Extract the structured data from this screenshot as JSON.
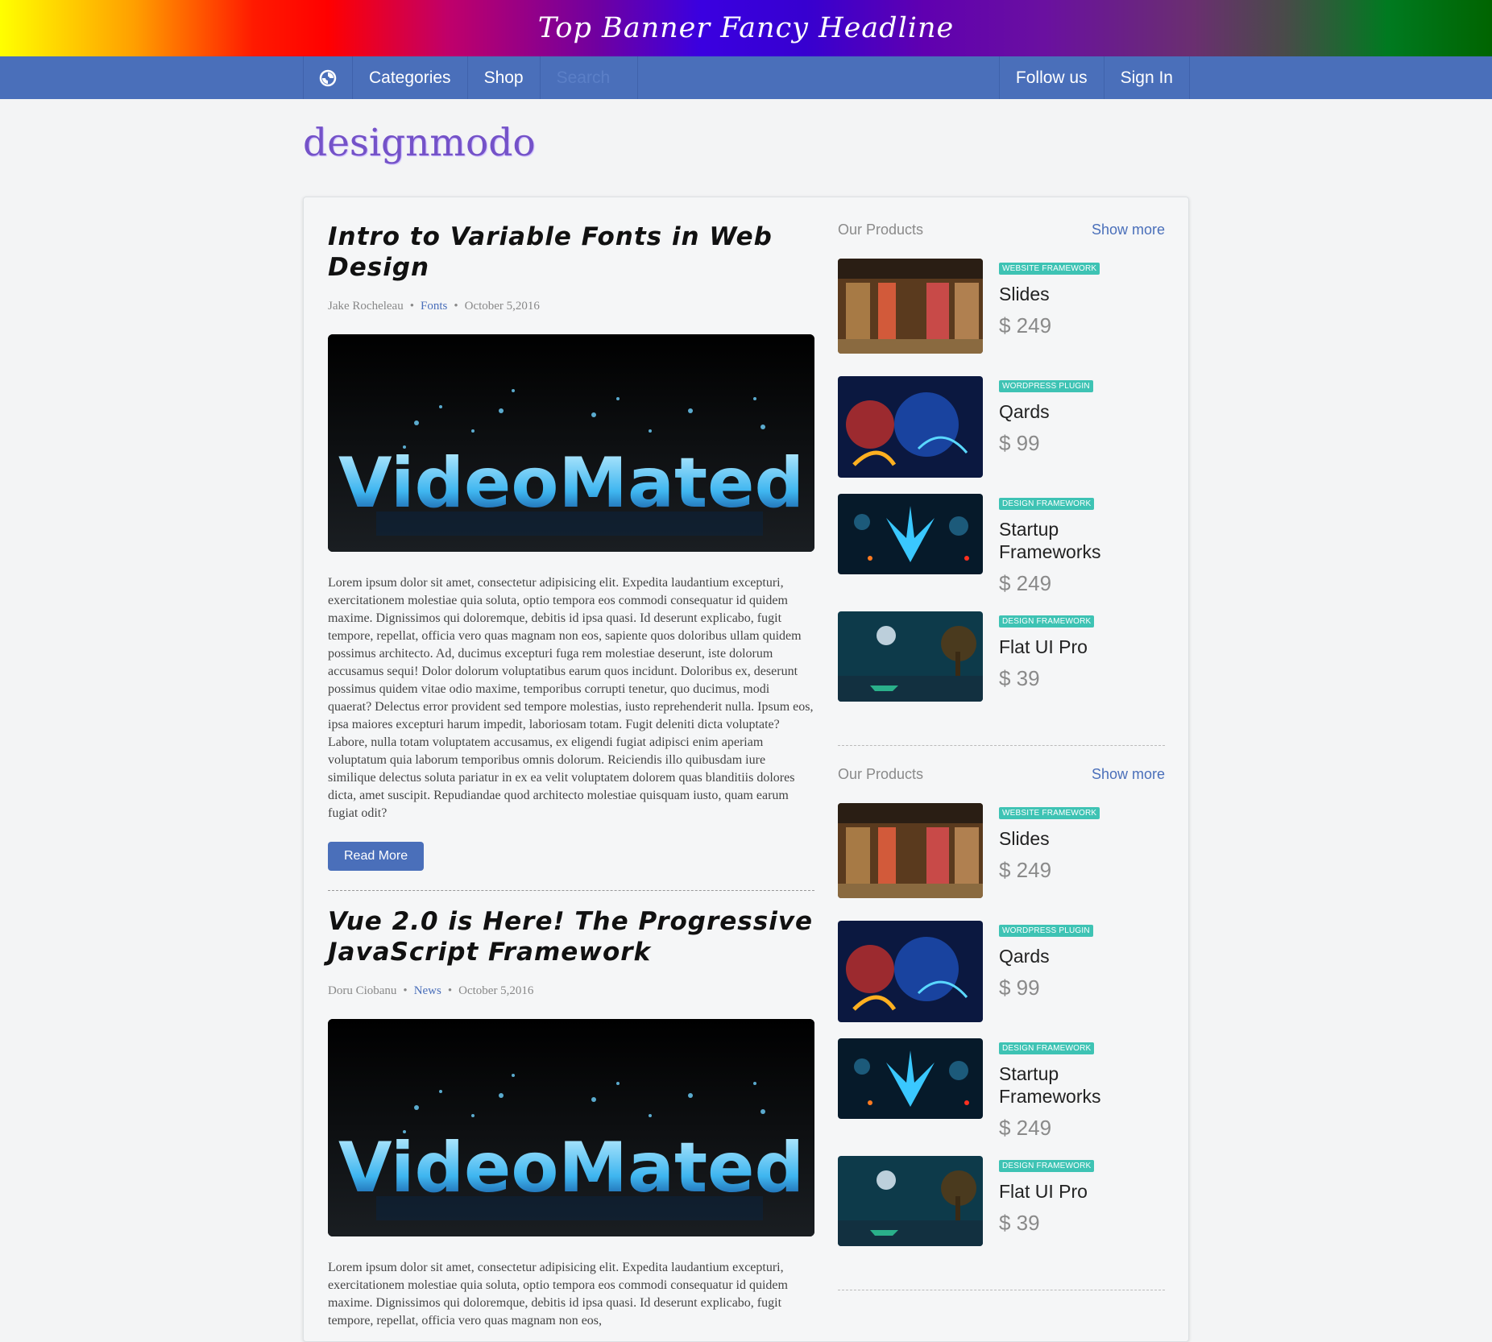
{
  "banner": {
    "headline": "Top Banner Fancy Headline"
  },
  "nav": {
    "logo_icon": "swirl-logo-icon",
    "left": [
      "Categories",
      "Shop"
    ],
    "search_placeholder": "Search",
    "right": [
      "Follow us",
      "Sign In"
    ]
  },
  "brand": "designmodo",
  "posts": [
    {
      "title": "Intro to Variable Fonts in Web Design",
      "author": "Jake Rocheleau",
      "category": "Fonts",
      "date": "October 5,2016",
      "image_text": "VideoMated",
      "excerpt": "Lorem ipsum dolor sit amet, consectetur adipisicing elit. Expedita laudantium excepturi, exercitationem molestiae quia soluta, optio tempora eos commodi consequatur id quidem maxime. Dignissimos qui doloremque, debitis id ipsa quasi. Id deserunt explicabo, fugit tempore, repellat, officia vero quas magnam non eos, sapiente quos doloribus ullam quidem possimus architecto. Ad, ducimus excepturi fuga rem molestiae deserunt, iste dolorum accusamus sequi! Dolor dolorum voluptatibus earum quos incidunt. Doloribus ex, deserunt possimus quidem vitae odio maxime, temporibus corrupti tenetur, quo ducimus, modi quaerat? Delectus error provident sed tempore molestias, iusto reprehenderit nulla. Ipsum eos, ipsa maiores excepturi harum impedit, laboriosam totam. Fugit deleniti dicta voluptate? Labore, nulla totam voluptatem accusamus, ex eligendi fugiat adipisci enim aperiam voluptatum quia laborum temporibus omnis dolorum. Reiciendis illo quibusdam iure similique delectus soluta pariatur in ex ea velit voluptatem dolorem quas blanditiis dolores dicta, amet suscipit. Repudiandae quod architecto molestiae quisquam iusto, quam earum fugiat odit?",
      "button": "Read More"
    },
    {
      "title": "Vue 2.0 is Here! The Progressive JavaScript Framework",
      "author": "Doru Ciobanu",
      "category": "News",
      "date": "October 5,2016",
      "image_text": "VideoMated",
      "excerpt": "Lorem ipsum dolor sit amet, consectetur adipisicing elit. Expedita laudantium excepturi, exercitationem molestiae quia soluta, optio tempora eos commodi consequatur id quidem maxime. Dignissimos qui doloremque, debitis id ipsa quasi. Id deserunt explicabo, fugit tempore, repellat, officia vero quas magnam non eos,"
    }
  ],
  "sidebar": [
    {
      "label": "Our Products",
      "more": "Show more",
      "products": [
        {
          "badge": "WEBSITE FRAMEWORK",
          "name": "Slides",
          "price": "$ 249"
        },
        {
          "badge": "WORDPRESS PLUGIN",
          "name": "Qards",
          "price": "$ 99"
        },
        {
          "badge": "DESIGN FRAMEWORK",
          "name": "Startup Frameworks",
          "price": "$ 249"
        },
        {
          "badge": "DESIGN FRAMEWORK",
          "name": "Flat UI Pro",
          "price": "$ 39"
        }
      ]
    },
    {
      "label": "Our Products",
      "more": "Show more",
      "products": [
        {
          "badge": "WEBSITE FRAMEWORK",
          "name": "Slides",
          "price": "$ 249"
        },
        {
          "badge": "WORDPRESS PLUGIN",
          "name": "Qards",
          "price": "$ 99"
        },
        {
          "badge": "DESIGN FRAMEWORK",
          "name": "Startup Frameworks",
          "price": "$ 249"
        },
        {
          "badge": "DESIGN FRAMEWORK",
          "name": "Flat UI Pro",
          "price": "$ 39"
        }
      ]
    }
  ],
  "colors": {
    "nav": "#4a6fba",
    "badge": "#3ec3b4",
    "brand": "#7452c8"
  }
}
